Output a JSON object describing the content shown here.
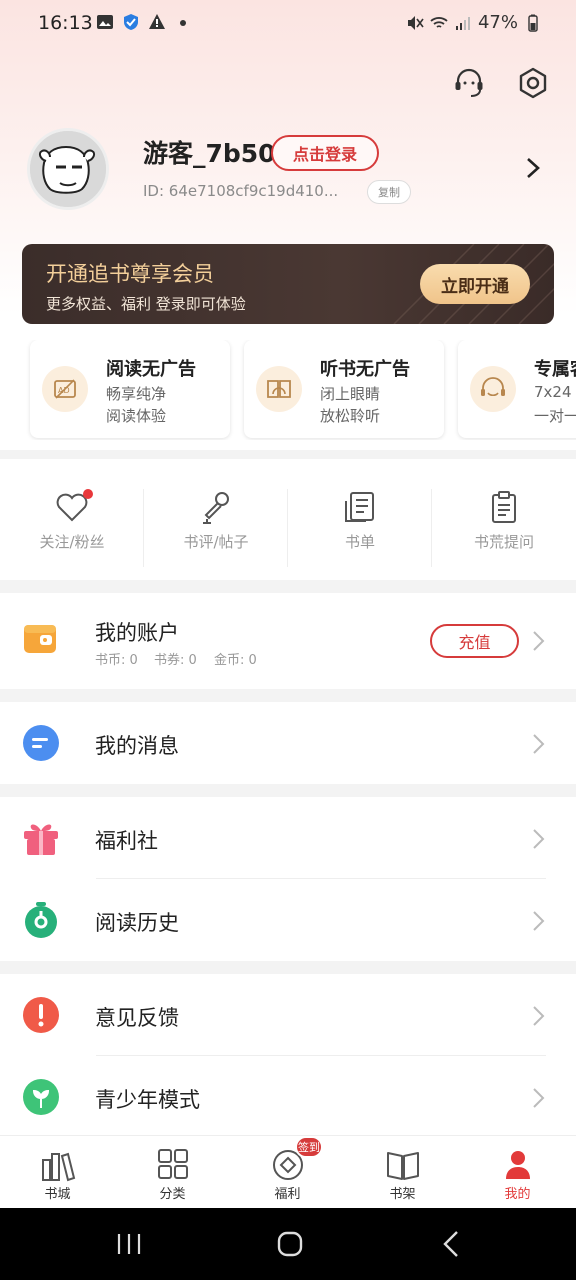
{
  "status_bar": {
    "time": "16:13",
    "battery": "47%"
  },
  "profile": {
    "username": "游客_7b50",
    "login_label": "点击登录",
    "user_id": "ID: 64e7108cf9c19d410...",
    "copy_label": "复制"
  },
  "vip": {
    "title": "开通追书尊享会员",
    "subtitle": "更多权益、福利 登录即可体验",
    "button": "立即开通"
  },
  "benefits": [
    {
      "title": "阅读无广告",
      "line1": "畅享纯净",
      "line2": "阅读体验"
    },
    {
      "title": "听书无广告",
      "line1": "闭上眼睛",
      "line2": "放松聆听"
    },
    {
      "title": "专属客服",
      "line1": "7x24",
      "line2": "一对一"
    }
  ],
  "quick_links": [
    {
      "label": "关注/粉丝"
    },
    {
      "label": "书评/帖子"
    },
    {
      "label": "书单"
    },
    {
      "label": "书荒提问"
    }
  ],
  "account": {
    "label": "我的账户",
    "recharge": "充值",
    "book_coins": "书币: 0",
    "vouchers": "书券: 0",
    "gold": "金币: 0"
  },
  "menu": {
    "messages": "我的消息",
    "welfare": "福利社",
    "history": "阅读历史",
    "feedback": "意见反馈",
    "teen_mode": "青少年模式"
  },
  "tabs": [
    {
      "label": "书城"
    },
    {
      "label": "分类"
    },
    {
      "label": "福利"
    },
    {
      "label": "书架"
    },
    {
      "label": "我的"
    }
  ],
  "checkin_badge": "签到",
  "colors": {
    "accent": "#d63b3b",
    "vip_gold": "#f3cf9a"
  }
}
